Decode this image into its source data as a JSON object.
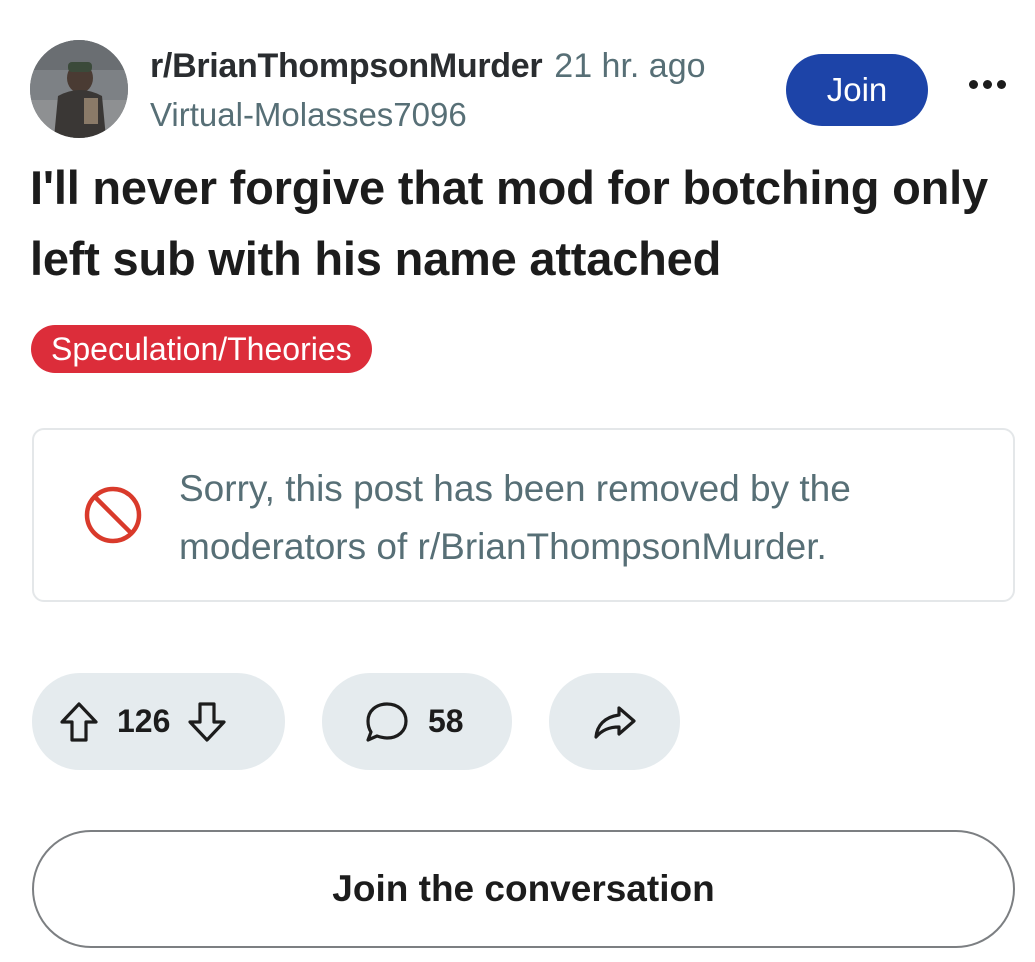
{
  "post": {
    "subreddit": "r/BrianThompsonMurder",
    "time": "21 hr. ago",
    "author": "Virtual-Molasses7096",
    "join_label": "Join",
    "title": "I'll never forgive that mod for botching only left sub with his name attached",
    "flair": "Speculation/Theories",
    "removed_message": "Sorry, this post has been removed by the moderators of r/BrianThompsonMurder."
  },
  "actions": {
    "upvote_count": "126",
    "comment_count": "58"
  },
  "footer": {
    "join_conversation_label": "Join the conversation"
  },
  "colors": {
    "join_button": "#1d44a8",
    "flair_bg": "#dc2d3a",
    "ban_icon": "#d93a2b",
    "pill_bg": "#e5ebee"
  },
  "icons": [
    "subreddit-avatar",
    "more-options-icon",
    "ban-icon",
    "upvote-icon",
    "downvote-icon",
    "comment-icon",
    "share-icon"
  ]
}
